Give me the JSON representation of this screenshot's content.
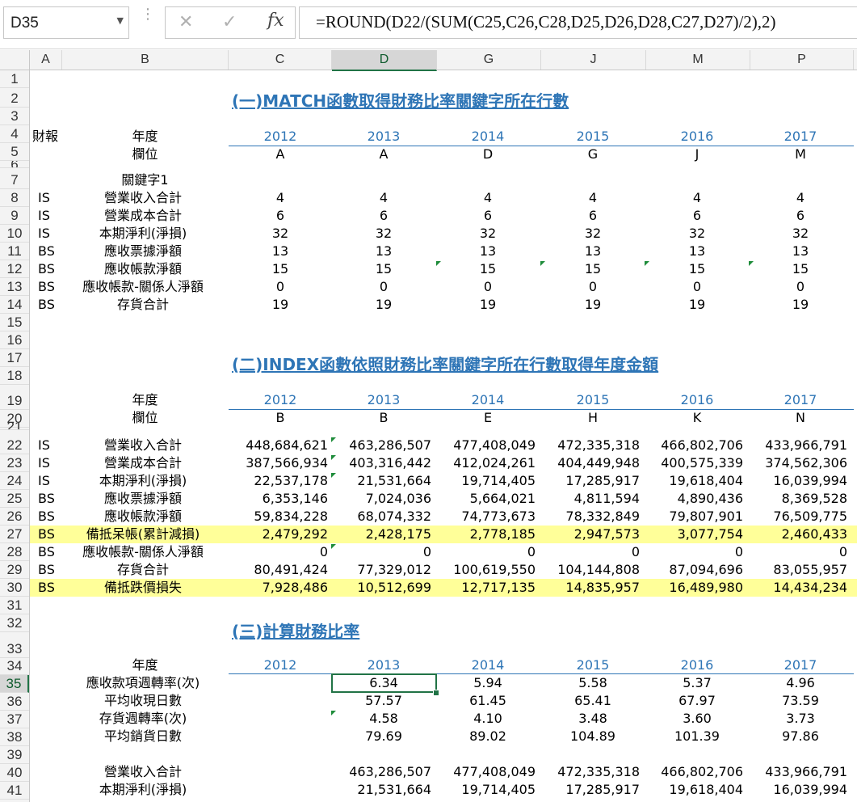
{
  "formula_bar": {
    "name_box": "D35",
    "fx_label": "fx",
    "cancel_glyph": "✕",
    "enter_glyph": "✓",
    "formula": "=ROUND(D22/(SUM(C25,C26,C28,D25,D26,D28,C27,D27)/2),2)"
  },
  "columns": [
    "A",
    "B",
    "C",
    "D",
    "G",
    "J",
    "M",
    "P"
  ],
  "rows": [
    "1",
    "2",
    "3",
    "4",
    "5",
    "6",
    "7",
    "8",
    "9",
    "10",
    "11",
    "12",
    "13",
    "14",
    "15",
    "16",
    "17",
    "18",
    "19",
    "20",
    "21",
    "22",
    "23",
    "24",
    "25",
    "26",
    "27",
    "28",
    "29",
    "30",
    "31",
    "32",
    "33",
    "34",
    "35",
    "36",
    "37",
    "38",
    "39",
    "40",
    "41"
  ],
  "section1": {
    "title": "(一)MATCH函數取得財務比率關鍵字所在行數",
    "report_label": "財報",
    "year_label": "年度",
    "field_label": "欄位",
    "years": [
      "2012",
      "2013",
      "2014",
      "2015",
      "2016",
      "2017"
    ],
    "fields": [
      "A",
      "A",
      "D",
      "G",
      "J",
      "M"
    ],
    "keyword_label": "關鍵字1",
    "rows": [
      {
        "type": "IS",
        "name": "營業收入合計",
        "vals": [
          "4",
          "4",
          "4",
          "4",
          "4",
          "4"
        ]
      },
      {
        "type": "IS",
        "name": "營業成本合計",
        "vals": [
          "6",
          "6",
          "6",
          "6",
          "6",
          "6"
        ]
      },
      {
        "type": "IS",
        "name": "本期淨利(淨損)",
        "vals": [
          "32",
          "32",
          "32",
          "32",
          "32",
          "32"
        ]
      },
      {
        "type": "BS",
        "name": "應收票據淨額",
        "vals": [
          "13",
          "13",
          "13",
          "13",
          "13",
          "13"
        ]
      },
      {
        "type": "BS",
        "name": "應收帳款淨額",
        "vals": [
          "15",
          "15",
          "15",
          "15",
          "15",
          "15"
        ]
      },
      {
        "type": "BS",
        "name": "應收帳款-關係人淨額",
        "vals": [
          "0",
          "0",
          "0",
          "0",
          "0",
          "0"
        ]
      },
      {
        "type": "BS",
        "name": "存貨合計",
        "vals": [
          "19",
          "19",
          "19",
          "19",
          "19",
          "19"
        ]
      }
    ]
  },
  "section2": {
    "title": "(二)INDEX函數依照財務比率關鍵字所在行數取得年度金額",
    "year_label": "年度",
    "field_label": "欄位",
    "years": [
      "2012",
      "2013",
      "2014",
      "2015",
      "2016",
      "2017"
    ],
    "fields": [
      "B",
      "B",
      "E",
      "H",
      "K",
      "N"
    ],
    "rows": [
      {
        "type": "IS",
        "name": "營業收入合計",
        "vals": [
          "448,684,621",
          "463,286,507",
          "477,408,049",
          "472,335,318",
          "466,802,706",
          "433,966,791"
        ]
      },
      {
        "type": "IS",
        "name": "營業成本合計",
        "vals": [
          "387,566,934",
          "403,316,442",
          "412,024,261",
          "404,449,948",
          "400,575,339",
          "374,562,306"
        ]
      },
      {
        "type": "IS",
        "name": "本期淨利(淨損)",
        "vals": [
          "22,537,178",
          "21,531,664",
          "19,714,405",
          "17,285,917",
          "19,618,404",
          "16,039,994"
        ]
      },
      {
        "type": "BS",
        "name": "應收票據淨額",
        "vals": [
          "6,353,146",
          "7,024,036",
          "5,664,021",
          "4,811,594",
          "4,890,436",
          "8,369,528"
        ]
      },
      {
        "type": "BS",
        "name": "應收帳款淨額",
        "vals": [
          "59,834,228",
          "68,074,332",
          "74,773,673",
          "78,332,849",
          "79,807,901",
          "76,509,775"
        ]
      },
      {
        "type": "BS",
        "name": "備抵呆帳(累計減損)",
        "vals": [
          "2,479,292",
          "2,428,175",
          "2,778,185",
          "2,947,573",
          "3,077,754",
          "2,460,433"
        ]
      },
      {
        "type": "BS",
        "name": "應收帳款-關係人淨額",
        "vals": [
          "0",
          "0",
          "0",
          "0",
          "0",
          "0"
        ]
      },
      {
        "type": "BS",
        "name": "存貨合計",
        "vals": [
          "80,491,424",
          "77,329,012",
          "100,619,550",
          "104,144,808",
          "87,094,696",
          "83,055,957"
        ]
      },
      {
        "type": "BS",
        "name": "備抵跌價損失",
        "vals": [
          "7,928,486",
          "10,512,699",
          "12,717,135",
          "14,835,957",
          "16,489,980",
          "14,434,234"
        ]
      }
    ]
  },
  "section3": {
    "title": "(三)計算財務比率",
    "year_label": "年度",
    "years": [
      "2012",
      "2013",
      "2014",
      "2015",
      "2016",
      "2017"
    ],
    "rows": [
      {
        "name": "應收款項週轉率(次)",
        "vals": [
          "",
          "6.34",
          "5.94",
          "5.58",
          "5.37",
          "4.96"
        ]
      },
      {
        "name": "平均收現日數",
        "vals": [
          "",
          "57.57",
          "61.45",
          "65.41",
          "67.97",
          "73.59"
        ]
      },
      {
        "name": "存貨週轉率(次)",
        "vals": [
          "",
          "4.58",
          "4.10",
          "3.48",
          "3.60",
          "3.73"
        ]
      },
      {
        "name": "平均銷貨日數",
        "vals": [
          "",
          "79.69",
          "89.02",
          "104.89",
          "101.39",
          "97.86"
        ]
      }
    ],
    "extra": [
      {
        "name": "營業收入合計",
        "vals": [
          "",
          "463,286,507",
          "477,408,049",
          "472,335,318",
          "466,802,706",
          "433,966,791"
        ]
      },
      {
        "name": "本期淨利(淨損)",
        "vals": [
          "",
          "21,531,664",
          "19,714,405",
          "17,285,917",
          "19,618,404",
          "16,039,994"
        ]
      }
    ]
  }
}
